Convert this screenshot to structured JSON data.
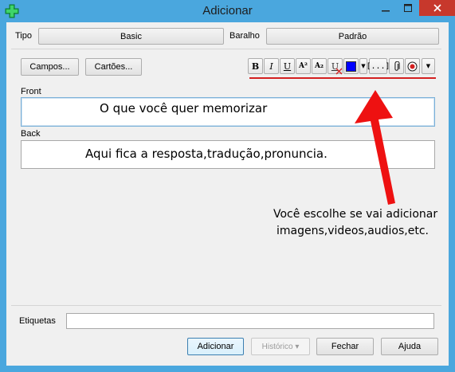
{
  "window": {
    "title": "Adicionar"
  },
  "header": {
    "type_label": "Tipo",
    "type_value": "Basic",
    "deck_label": "Baralho",
    "deck_value": "Padrão"
  },
  "toolbar": {
    "fields_button": "Campos...",
    "cards_button": "Cartões...",
    "bold": "B",
    "italic": "I",
    "underline": "U",
    "superscript": "A²",
    "subscript": "A₂",
    "clear_format": "U",
    "cloze": "[...]",
    "color_swatch": "#0000ff"
  },
  "fields": {
    "front_label": "Front",
    "front_value": "O que você quer memorizar",
    "back_label": "Back",
    "back_value": "Aqui fica a resposta,tradução,pronuncia."
  },
  "annotation": {
    "line1": "Você escolhe se vai adicionar",
    "line2": "imagens,videos,audios,etc.",
    "color": "#ee1111"
  },
  "footer": {
    "tags_label": "Etiquetas",
    "tags_value": "",
    "add_button": "Adicionar",
    "history_button": "Histórico ▾",
    "close_button": "Fechar",
    "help_button": "Ajuda"
  }
}
